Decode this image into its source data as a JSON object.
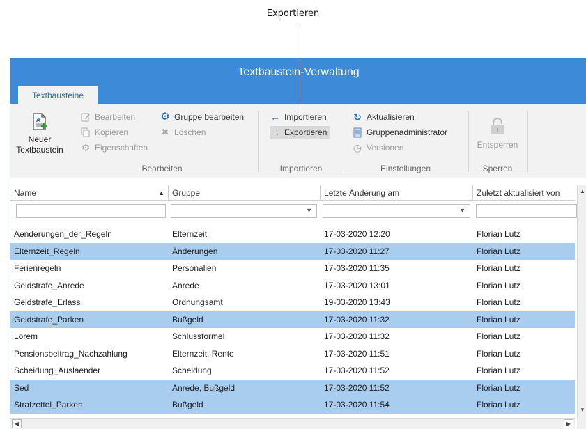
{
  "callout": {
    "text": "Exportieren"
  },
  "window": {
    "title": "Textbaustein-Verwaltung"
  },
  "tabs": [
    {
      "label": "Textbausteine"
    }
  ],
  "ribbon": {
    "bearbeiten": {
      "big_button": {
        "line1": "Neuer",
        "line2": "Textbaustein",
        "icon": "new-document-icon"
      },
      "items": [
        {
          "label": "Bearbeiten",
          "icon": "edit-icon",
          "enabled": false
        },
        {
          "label": "Kopieren",
          "icon": "copy-icon",
          "enabled": false
        },
        {
          "label": "Eigenschaften",
          "icon": "gear-icon",
          "enabled": false
        },
        {
          "label": "Gruppe bearbeiten",
          "icon": "gear-icon",
          "enabled": true
        },
        {
          "label": "Löschen",
          "icon": "delete-icon",
          "enabled": false
        }
      ],
      "group_label": "Bearbeiten"
    },
    "importieren": {
      "items": [
        {
          "label": "Importieren",
          "icon": "arrow-left-icon",
          "enabled": true
        },
        {
          "label": "Exportieren",
          "icon": "arrow-right-icon",
          "enabled": true,
          "highlighted": true
        }
      ],
      "group_label": "Importieren"
    },
    "einstellungen": {
      "items": [
        {
          "label": "Aktualisieren",
          "icon": "refresh-icon",
          "enabled": true
        },
        {
          "label": "Gruppenadministrator",
          "icon": "admin-document-icon",
          "enabled": true
        },
        {
          "label": "Versionen",
          "icon": "clock-icon",
          "enabled": false
        }
      ],
      "group_label": "Einstellungen"
    },
    "sperren": {
      "big_button": {
        "label": "Entsperren",
        "icon": "unlock-icon",
        "enabled": false
      },
      "group_label": "Sperren"
    }
  },
  "table": {
    "columns": [
      "Name",
      "Gruppe",
      "Letzte Änderung am",
      "Zuletzt aktualisiert von"
    ],
    "sort_column": "Name",
    "rows": [
      {
        "name": "Aenderungen_der_Regeln",
        "gruppe": "Elternzeit",
        "datum": "17-03-2020 12:20",
        "von": "Florian Lutz",
        "selected": false
      },
      {
        "name": "Elternzeit_Regeln",
        "gruppe": "Änderungen",
        "datum": "17-03-2020 11:27",
        "von": "Florian Lutz",
        "selected": true
      },
      {
        "name": "Ferienregeln",
        "gruppe": "Personalien",
        "datum": "17-03-2020 11:35",
        "von": "Florian Lutz",
        "selected": false
      },
      {
        "name": "Geldstrafe_Anrede",
        "gruppe": "Anrede",
        "datum": "17-03-2020 13:01",
        "von": "Florian Lutz",
        "selected": false
      },
      {
        "name": "Geldstrafe_Erlass",
        "gruppe": "Ordnungsamt",
        "datum": "19-03-2020 13:43",
        "von": "Florian Lutz",
        "selected": false
      },
      {
        "name": "Geldstrafe_Parken",
        "gruppe": "Bußgeld",
        "datum": "17-03-2020 11:32",
        "von": "Florian Lutz",
        "selected": true
      },
      {
        "name": "Lorem",
        "gruppe": "Schlussformel",
        "datum": "17-03-2020 11:32",
        "von": "Florian Lutz",
        "selected": false
      },
      {
        "name": "Pensionsbeitrag_Nachzahlung",
        "gruppe": "Elternzeit, Rente",
        "datum": "17-03-2020 11:51",
        "von": "Florian Lutz",
        "selected": false
      },
      {
        "name": "Scheidung_Auslaender",
        "gruppe": "Scheidung",
        "datum": "17-03-2020 11:52",
        "von": "Florian Lutz",
        "selected": false
      },
      {
        "name": "Sed",
        "gruppe": "Anrede, Bußgeld",
        "datum": "17-03-2020 11:52",
        "von": "Florian Lutz",
        "selected": true
      },
      {
        "name": "Strafzettel_Parken",
        "gruppe": "Bußgeld",
        "datum": "17-03-2020 11:54",
        "von": "Florian Lutz",
        "selected": true
      }
    ]
  },
  "colors": {
    "title_bar": "#3c8ad8",
    "selection": "#a9cdef",
    "ribbon": "#f2f2f2"
  }
}
